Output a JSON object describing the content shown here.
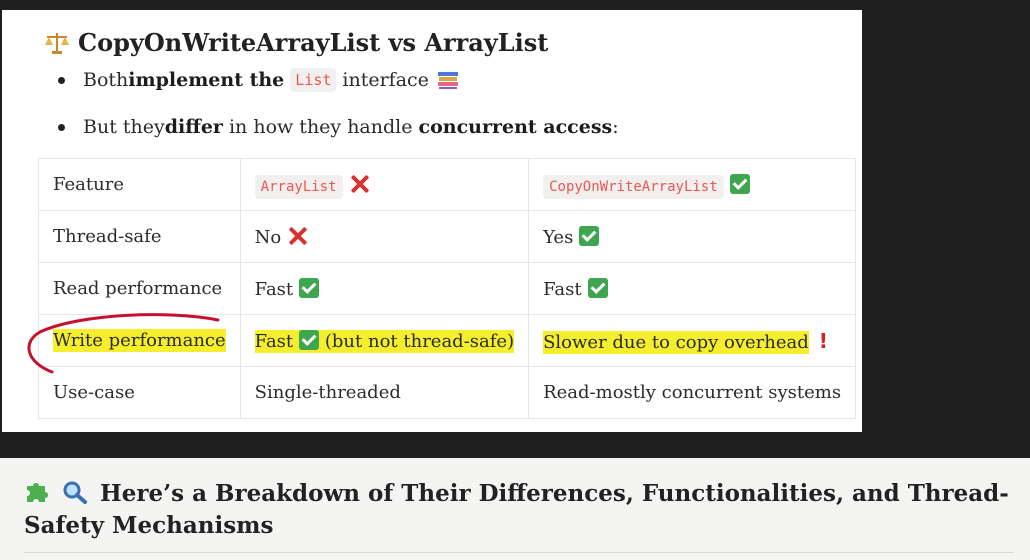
{
  "section": {
    "title": "CopyOnWriteArrayList vs ArrayList",
    "title_icon": "balance-scale-icon",
    "bullets": [
      {
        "pre": "Both ",
        "bold": "implement the",
        "code": "List",
        "post": "interface",
        "icon": "books-icon"
      },
      {
        "pre": "But they ",
        "bold": "differ",
        "mid": " in how they handle ",
        "bold2": "concurrent access",
        "post": ":"
      }
    ]
  },
  "table": {
    "header": {
      "feature": "Feature",
      "col1_code": "ArrayList",
      "col2_code": "CopyOnWriteArrayList"
    },
    "rows": [
      {
        "feature": "Thread-safe",
        "col1": "No",
        "col2": "Yes"
      },
      {
        "feature": "Read performance",
        "col1": "Fast",
        "col2": "Fast"
      },
      {
        "feature": "Write performance",
        "col1": "Fast",
        "col1_suffix": "(but not thread-safe)",
        "col2": "Slower due to copy overhead",
        "col2_mark": "!"
      },
      {
        "feature": "Use-case",
        "col1": "Single-threaded",
        "col2": "Read-mostly concurrent systems"
      }
    ]
  },
  "next_section": {
    "title": "Here’s a Breakdown of Their Differences, Functionalities, and Thread-Safety Mechanisms",
    "icons": [
      "puzzle-icon",
      "magnifier-icon"
    ]
  },
  "colors": {
    "highlight": "#f5ee2c",
    "check": "#3ea64f",
    "cross": "#d93030",
    "code_text": "#eb5757",
    "annotation": "#c8102e"
  }
}
